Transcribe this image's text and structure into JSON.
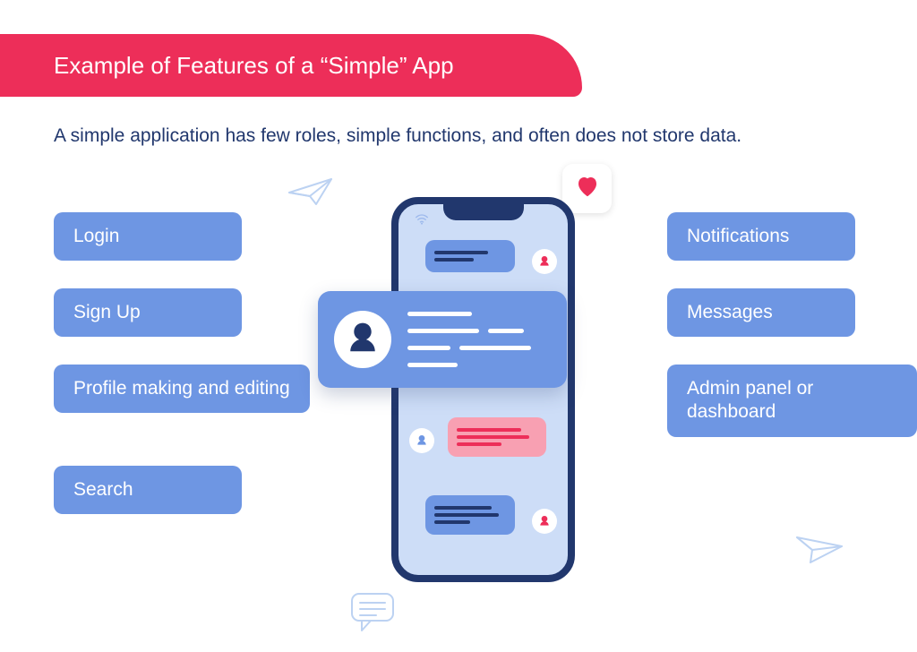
{
  "colors": {
    "accent": "#ed2e59",
    "pill": "#6e96e3",
    "text_dark": "#21376d",
    "phone_bg": "#cdddf7",
    "pink": "#f8a0b2"
  },
  "banner": {
    "title": "Example of Features of a “Simple” App"
  },
  "subtitle": "A simple application has few roles, simple functions, and often does not store data.",
  "features_left": [
    "Login",
    "Sign Up",
    "Profile making and editing",
    "Search"
  ],
  "features_right": [
    "Notifications",
    "Messages",
    "Admin panel or dashboard"
  ],
  "icons": {
    "heart": "heart-icon",
    "paper_plane_left": "paper-plane-icon",
    "paper_plane_right": "paper-plane-icon",
    "wifi": "wifi-icon",
    "chat_bubble": "chat-bubble-icon",
    "avatar": "person-icon"
  }
}
